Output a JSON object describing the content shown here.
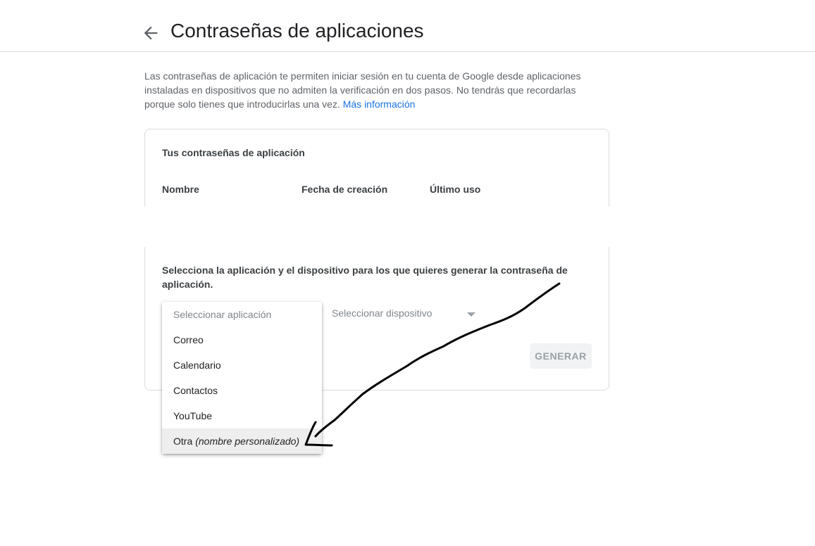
{
  "header": {
    "title": "Contraseñas de aplicaciones",
    "back_icon": "arrow-left-icon"
  },
  "intro": {
    "text": "Las contraseñas de aplicación te permiten iniciar sesión en tu cuenta de Google desde aplicaciones instaladas en dispositivos que no admiten la verificación en dos pasos. No tendrás que recordarlas porque solo tienes que introducirlas una vez.",
    "link": "Más información"
  },
  "card": {
    "title": "Tus contraseñas de aplicación",
    "columns": [
      "Nombre",
      "Fecha de creación",
      "Último uso"
    ],
    "select_description": "Selecciona la aplicación y el dispositivo para los que quieres generar la contraseña de aplicación.",
    "device_select": "Seleccionar dispositivo",
    "generate_button": "GENERAR"
  },
  "app_menu": {
    "placeholder": "Seleccionar aplicación",
    "items": [
      "Correo",
      "Calendario",
      "Contactos",
      "YouTube"
    ],
    "last_item": {
      "label": "Otra",
      "italic": "(nombre personalizado)"
    }
  },
  "colors": {
    "link": "#1a73e8",
    "text": "#202124",
    "muted": "#5f6368",
    "annotation": "#000000"
  }
}
